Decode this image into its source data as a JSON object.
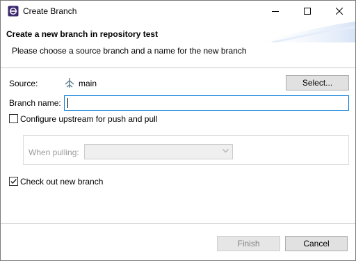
{
  "window": {
    "title": "Create Branch",
    "app_icon": "eclipse-icon",
    "controls": {
      "minimize": "minimize-icon",
      "maximize": "maximize-icon",
      "close": "close-icon"
    }
  },
  "header": {
    "title": "Create a new branch in repository test",
    "description": "Please choose a source branch and a name for the new branch"
  },
  "form": {
    "source_label": "Source:",
    "source_icon": "branch-icon",
    "source_value": "main",
    "select_button": "Select...",
    "branch_name_label": "Branch name:",
    "branch_name_value": "",
    "configure_upstream_label": "Configure upstream for push and pull",
    "configure_upstream_checked": false,
    "when_pulling_label": "When pulling:",
    "when_pulling_value": "",
    "checkout_label": "Check out new branch",
    "checkout_checked": true
  },
  "footer": {
    "finish_label": "Finish",
    "cancel_label": "Cancel"
  }
}
